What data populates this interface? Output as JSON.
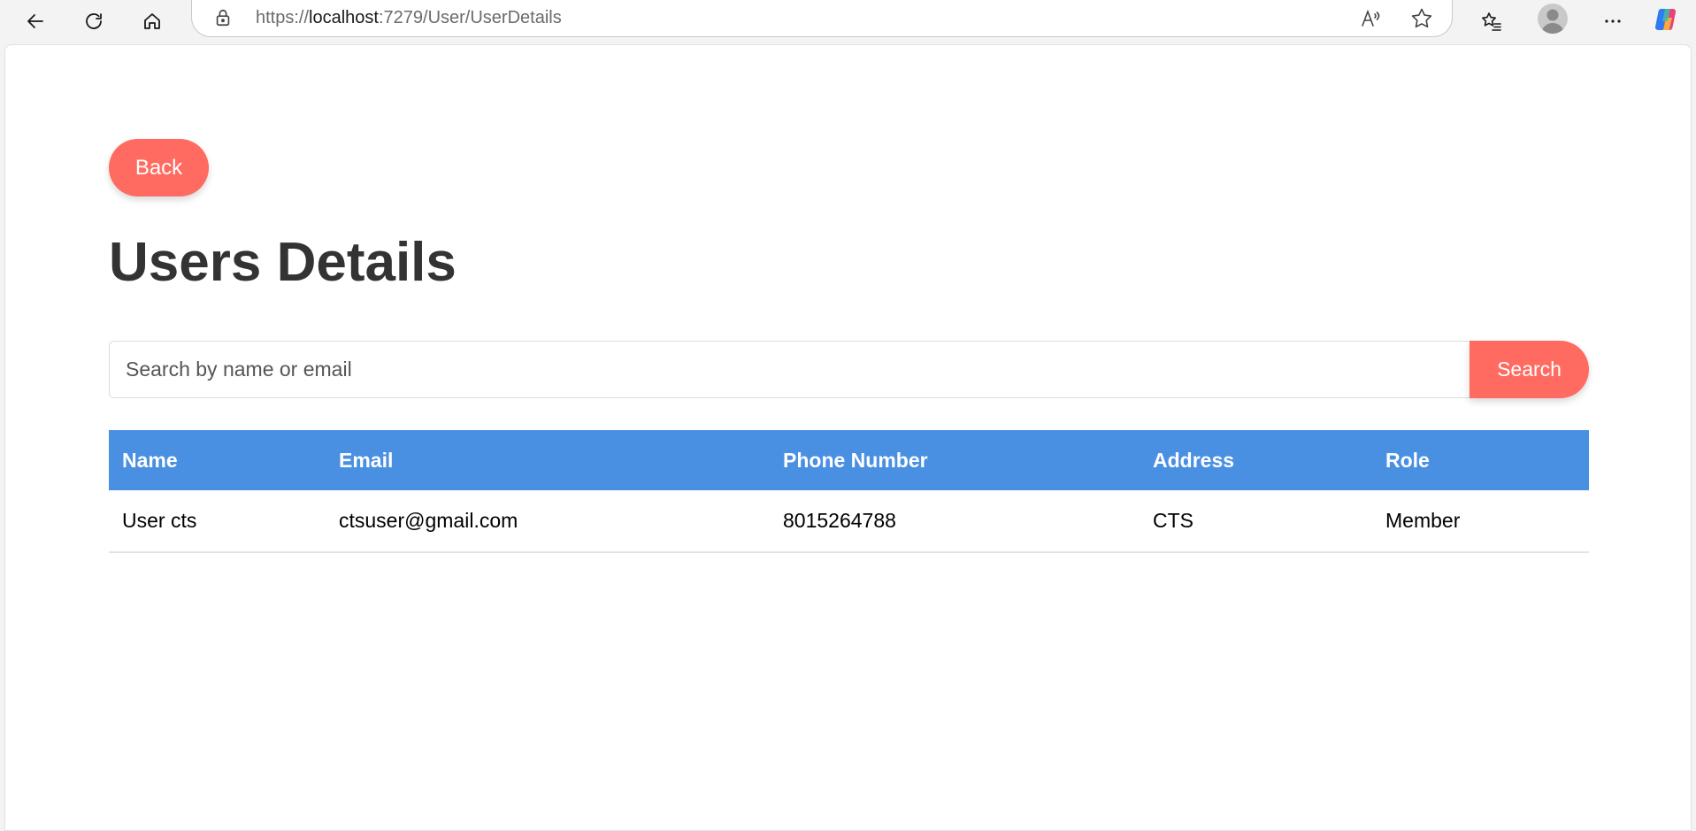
{
  "browser": {
    "url_scheme": "https://",
    "url_host": "localhost",
    "url_path": ":7279/User/UserDetails"
  },
  "page": {
    "back_label": "Back",
    "title": "Users Details",
    "search": {
      "placeholder": "Search by name or email",
      "value": "",
      "button_label": "Search"
    },
    "table": {
      "headers": [
        "Name",
        "Email",
        "Phone Number",
        "Address",
        "Role"
      ],
      "rows": [
        [
          "User cts",
          "ctsuser@gmail.com",
          "8015264788",
          "CTS",
          "Member"
        ]
      ]
    }
  },
  "colors": {
    "accent_button": "#ff6b61",
    "table_header": "#4a90e2",
    "title_text": "#333333"
  },
  "icons": {
    "toolbar": [
      "back-arrow-icon",
      "refresh-icon",
      "home-icon",
      "lock-icon",
      "read-aloud-icon",
      "favorite-star-icon",
      "favorites-list-icon",
      "profile-avatar-icon",
      "more-options-icon",
      "copilot-icon"
    ]
  }
}
